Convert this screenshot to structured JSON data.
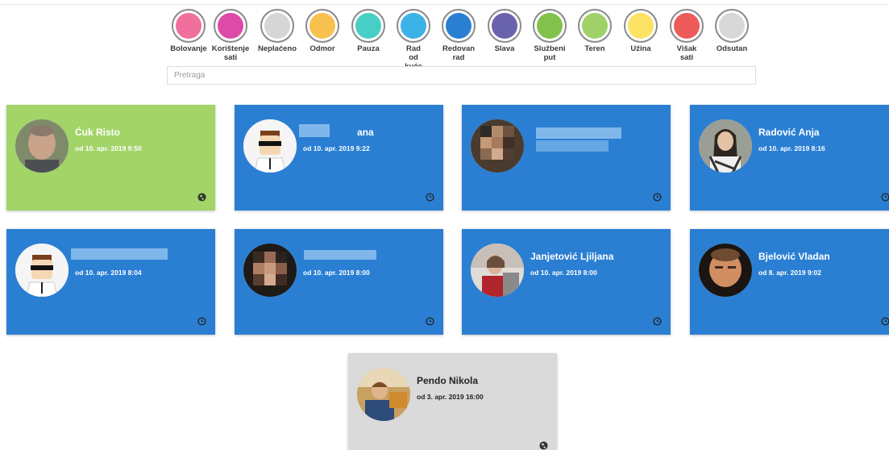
{
  "legend": [
    {
      "label": "Bolovanje",
      "color": "#f06f9d"
    },
    {
      "label": "Korištenje sati",
      "color": "#dd4aa8"
    },
    {
      "label": "Neplaćeno",
      "color": "#d6d6d6"
    },
    {
      "label": "Odmor",
      "color": "#f8c14e"
    },
    {
      "label": "Pauza",
      "color": "#47cfc5"
    },
    {
      "label": "Rad od kuće",
      "color": "#3db2e6"
    },
    {
      "label": "Redovan rad",
      "color": "#2a7fd3"
    },
    {
      "label": "Slava",
      "color": "#6a63ae"
    },
    {
      "label": "Službeni put",
      "color": "#82c14b"
    },
    {
      "label": "Teren",
      "color": "#9ed269"
    },
    {
      "label": "Užina",
      "color": "#fbe262"
    },
    {
      "label": "Višak sati",
      "color": "#ed5a5a"
    },
    {
      "label": "Odsutan",
      "color": "#d8d8d8"
    }
  ],
  "search": {
    "placeholder": "Pretraga"
  },
  "colors": {
    "redovan": "#2a7fd3",
    "teren": "#a2d468",
    "odsutan": "#dadada"
  },
  "employees": [
    {
      "name": "Ćuk Risto",
      "since": "od 10. apr. 2019 9:50",
      "status_icon": "globe-icon"
    },
    {
      "name": "ana",
      "since": "od 10. apr. 2019 9:22",
      "status_icon": "clock-icon"
    },
    {
      "name": "",
      "since": "",
      "status_icon": "clock-icon"
    },
    {
      "name": "Radović Anja",
      "since": "od 10. apr. 2019 8:16",
      "status_icon": "clock-icon"
    },
    {
      "name": "",
      "since": "od 10. apr. 2019 8:04",
      "status_icon": "clock-icon"
    },
    {
      "name": "",
      "since": "od 10. apr. 2019 8:00",
      "status_icon": "clock-icon"
    },
    {
      "name": "Janjetović Ljiljana",
      "since": "od 10. apr. 2019 8:00",
      "status_icon": "clock-icon"
    },
    {
      "name": "Bjelović Vladan",
      "since": "od 8. apr. 2019 9:02",
      "status_icon": "clock-icon"
    },
    {
      "name": "Pendo Nikola",
      "since": "od 3. apr. 2019 16:00",
      "status_icon": "globe-icon"
    }
  ]
}
